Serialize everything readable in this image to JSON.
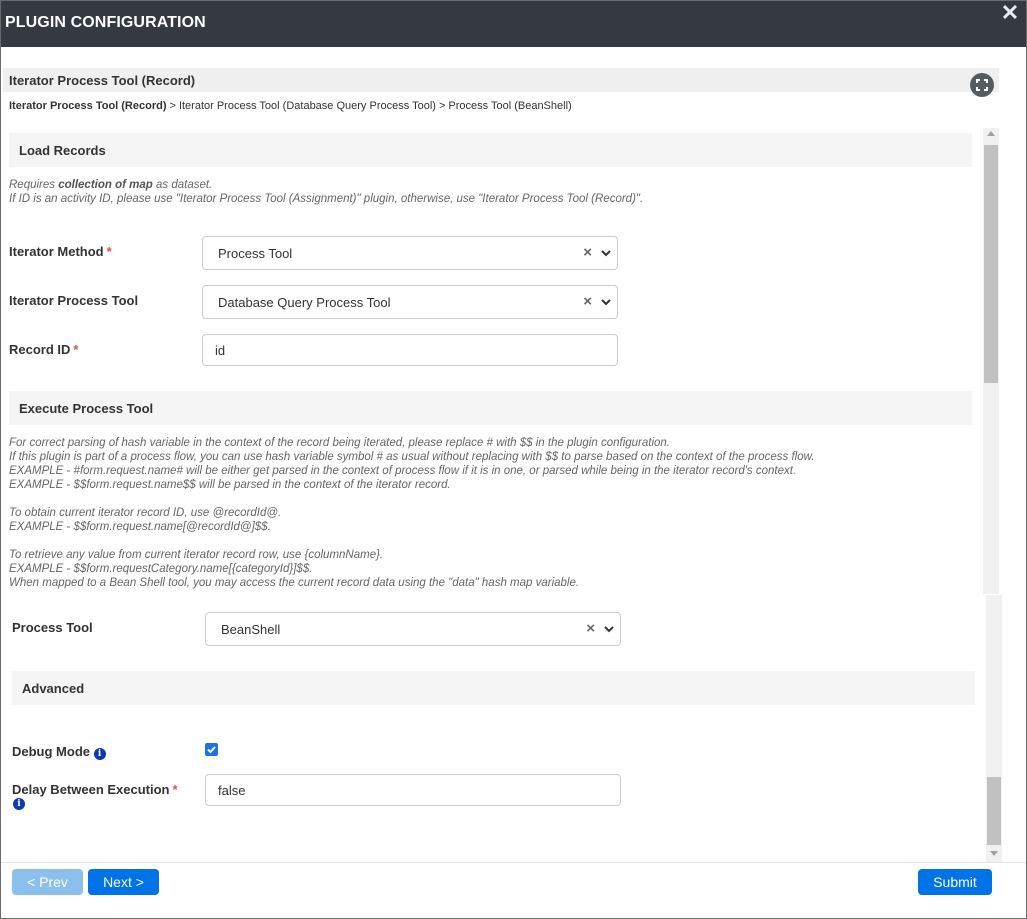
{
  "dialog": {
    "title": "PLUGIN CONFIGURATION",
    "close_icon": "close-icon"
  },
  "plugin": {
    "title": "Iterator Process Tool (Record)"
  },
  "breadcrumb": {
    "items": [
      "Iterator Process Tool (Record)",
      "Iterator Process Tool (Database Query Process Tool)",
      "Process Tool (BeanShell)"
    ],
    "separator": ">"
  },
  "load_records": {
    "title": "Load Records",
    "desc_line1_pre": "Requires ",
    "desc_line1_bold": "collection of map",
    "desc_line1_post": " as dataset.",
    "desc_line2": "If ID is an activity ID, please use \"Iterator Process Tool (Assignment)\" plugin, otherwise, use \"Iterator Process Tool (Record)\"."
  },
  "fields": {
    "iterator_method": {
      "label": "Iterator Method",
      "required": "*",
      "value": "Process Tool"
    },
    "iterator_process_tool": {
      "label": "Iterator Process Tool",
      "value": "Database Query Process Tool"
    },
    "record_id": {
      "label": "Record ID",
      "required": "*",
      "value": "id"
    }
  },
  "execute": {
    "title": "Execute Process Tool",
    "lines": [
      "For correct parsing of hash variable in the context of the record being iterated, please replace # with $$ in the plugin configuration.",
      "If this plugin is part of a process flow, you can use hash variable symbol # as usual without replacing with $$ to parse based on the context of the process flow.",
      "EXAMPLE - #form.request.name# will be either get parsed in the context of process flow if it is in one, or parsed while being in the iterator record's context.",
      "EXAMPLE - $$form.request.name$$ will be parsed in the context of the iterator record.",
      "",
      "To obtain current iterator record ID, use @recordId@.",
      "EXAMPLE - $$form.request.name[@recordId@]$$.",
      "",
      "To retrieve any value from current iterator record row, use {columnName}.",
      "EXAMPLE - $$form.requestCategory.name[{categoryId}]$$.",
      "When mapped to a Bean Shell tool, you may access the current record data using the \"data\" hash map variable."
    ]
  },
  "process_tool": {
    "label": "Process Tool",
    "value": "BeanShell"
  },
  "advanced": {
    "title": "Advanced",
    "debug_mode": {
      "label": "Debug Mode",
      "checked": true
    },
    "delay": {
      "label": "Delay Between Execution",
      "required": "*",
      "value": "false"
    }
  },
  "footer": {
    "prev": "< Prev",
    "next": "Next >",
    "submit": "Submit"
  },
  "colors": {
    "header_bg": "#343a40",
    "primary": "#0073e6",
    "prev_disabled": "#8cc0ec",
    "required": "#d9534f",
    "info": "#0b3ab3"
  }
}
